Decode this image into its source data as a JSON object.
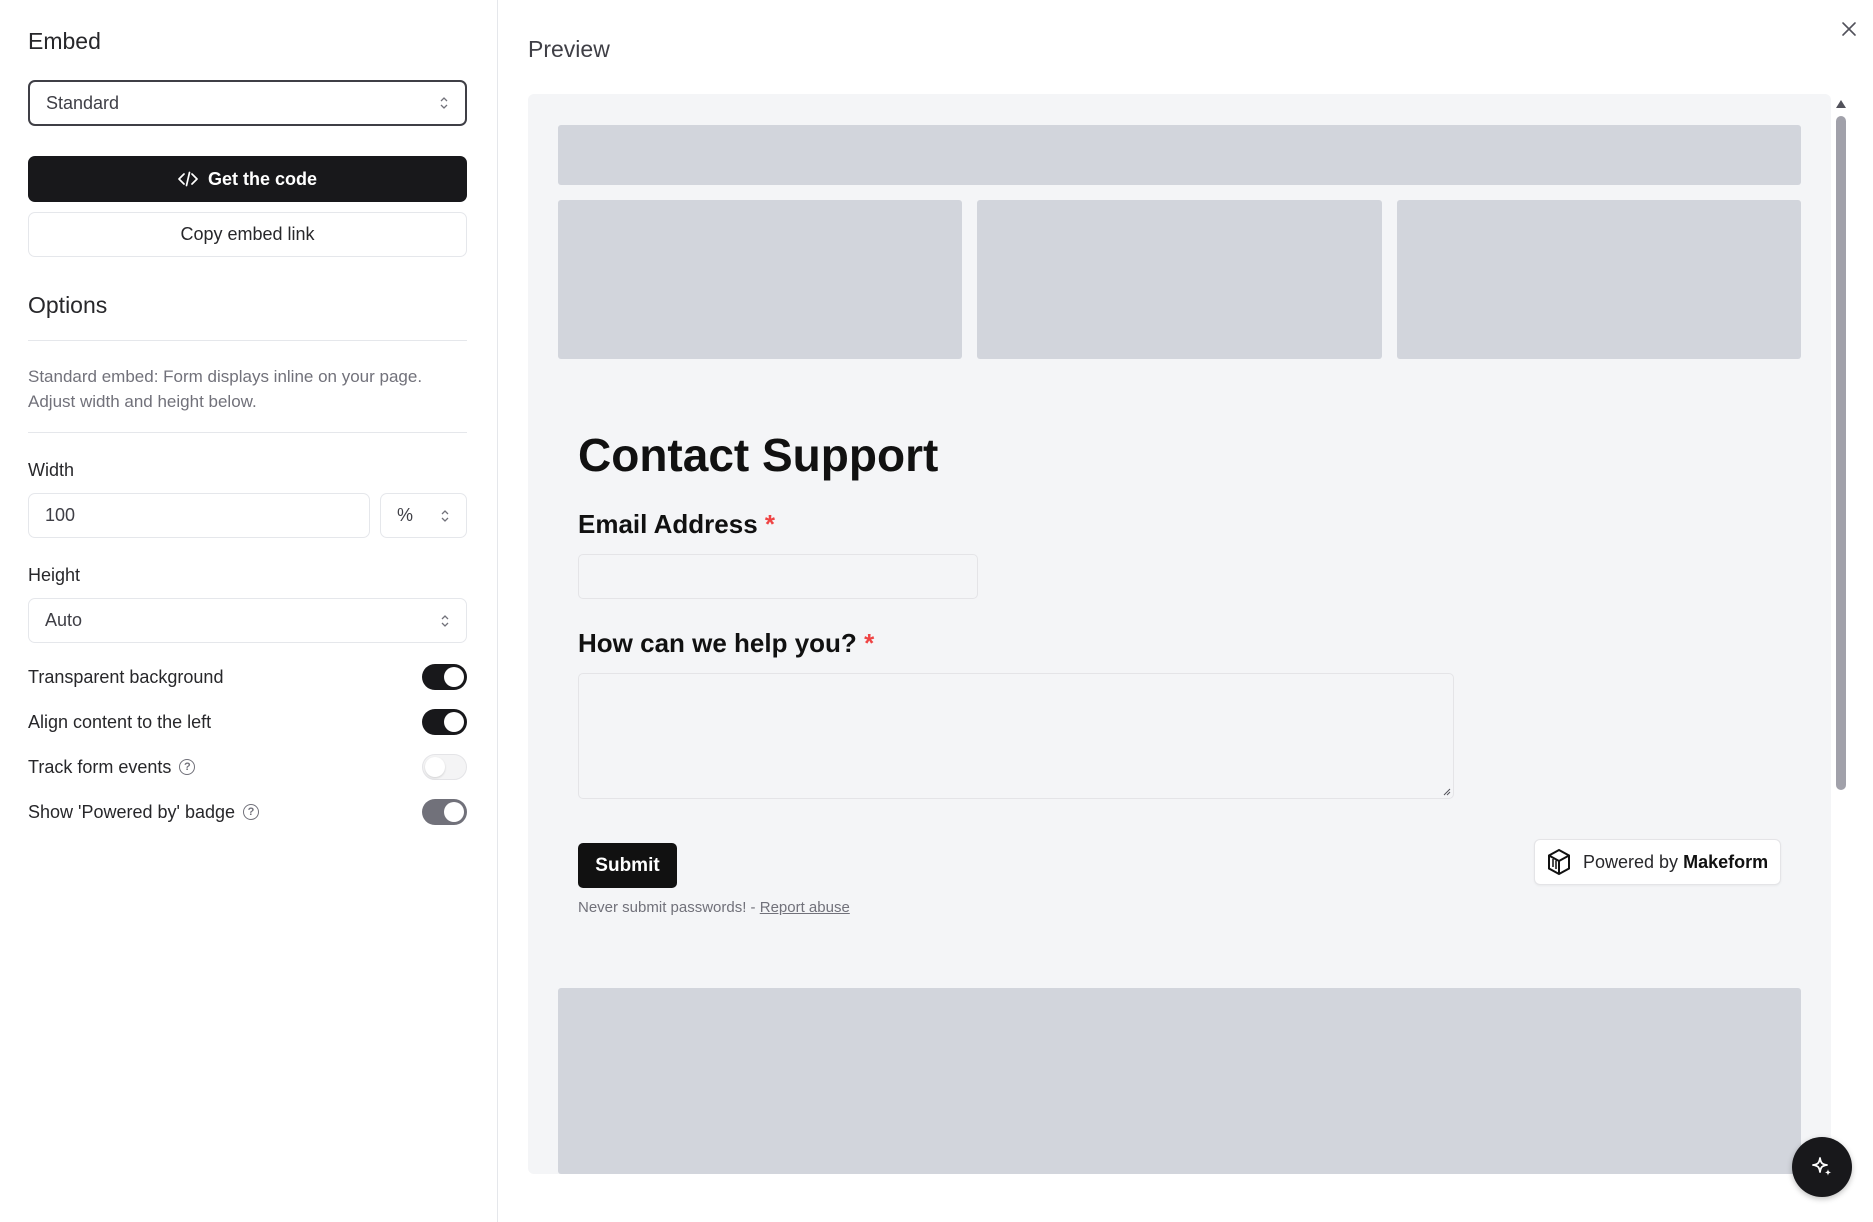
{
  "sidebar": {
    "title": "Embed",
    "embed_type": {
      "selected": "Standard"
    },
    "get_code_label": "Get the code",
    "copy_link_label": "Copy embed link",
    "options_title": "Options",
    "description": "Standard embed: Form displays inline on your page. Adjust width and height below.",
    "width": {
      "label": "Width",
      "value": "100",
      "unit": "%"
    },
    "height": {
      "label": "Height",
      "value": "Auto"
    },
    "toggles": [
      {
        "label": "Transparent background",
        "state": "on",
        "help": false
      },
      {
        "label": "Align content to the left",
        "state": "on",
        "help": false
      },
      {
        "label": "Track form events",
        "state": "off",
        "help": true
      },
      {
        "label": "Show 'Powered by' badge",
        "state": "on-disabled",
        "help": true
      }
    ]
  },
  "preview": {
    "title": "Preview",
    "form": {
      "title": "Contact Support",
      "fields": [
        {
          "label": "Email Address",
          "required": "*"
        },
        {
          "label": "How can we help you?",
          "required": "*"
        }
      ],
      "submit_label": "Submit",
      "footnote": "Never submit passwords! - ",
      "report_link": "Report abuse"
    },
    "badge": {
      "prefix": "Powered by",
      "brand": "Makeform"
    }
  },
  "icons": {
    "close": "close-icon",
    "code": "code-icon",
    "sparkle": "sparkle-icon",
    "logo": "makeform-logo-icon",
    "help": "?"
  }
}
